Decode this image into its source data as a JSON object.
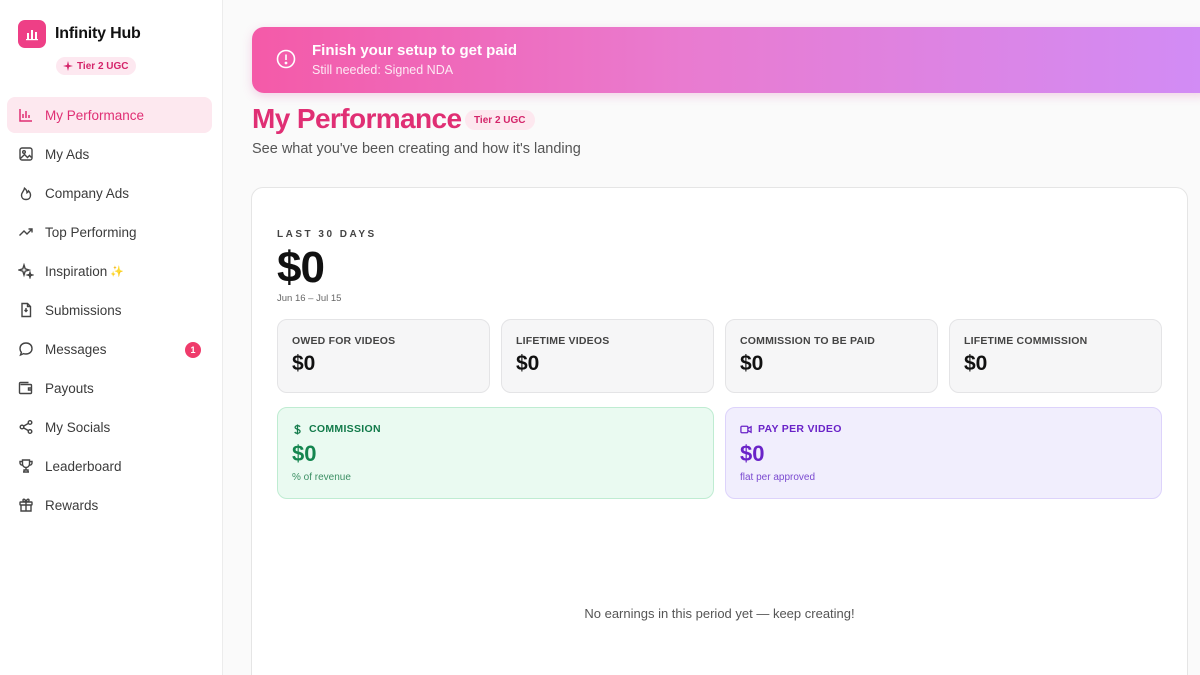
{
  "app": {
    "name": "Infinity Hub",
    "tier": "Tier 2 UGC",
    "brand_color": "#ee3f86"
  },
  "sidebar": {
    "items": [
      {
        "label": "My Performance",
        "icon": "bar-chart-icon",
        "active": true
      },
      {
        "label": "My Ads",
        "icon": "image-icon"
      },
      {
        "label": "Company Ads",
        "icon": "flame-icon"
      },
      {
        "label": "Top Performing",
        "icon": "trending-up-icon"
      },
      {
        "label": "Inspiration",
        "icon": "sparkles-icon",
        "suffix": "✨"
      },
      {
        "label": "Submissions",
        "icon": "file-icon"
      },
      {
        "label": "Messages",
        "icon": "message-icon",
        "badge": "1"
      },
      {
        "label": "Payouts",
        "icon": "wallet-icon"
      },
      {
        "label": "My Socials",
        "icon": "share-icon"
      },
      {
        "label": "Leaderboard",
        "icon": "trophy-icon"
      },
      {
        "label": "Rewards",
        "icon": "gift-icon"
      }
    ]
  },
  "banner": {
    "title": "Finish your setup to get paid",
    "subtitle": "Still needed: Signed NDA",
    "icon": "alert-circle-icon"
  },
  "header": {
    "title": "My Performance",
    "tier": "Tier 2 UGC",
    "subtitle": "See what you've been creating and how it's landing"
  },
  "period": {
    "label": "LAST 30 DAYS",
    "value": "$0",
    "range": "Jun 16 – Jul 15"
  },
  "stats": [
    {
      "label": "OWED FOR VIDEOS",
      "value": "$0"
    },
    {
      "label": "LIFETIME VIDEOS",
      "value": "$0"
    },
    {
      "label": "COMMISSION TO BE PAID",
      "value": "$0"
    },
    {
      "label": "LIFETIME COMMISSION",
      "value": "$0"
    }
  ],
  "rates": {
    "commission": {
      "label": "COMMISSION",
      "value": "$0",
      "sub": "% of revenue",
      "icon": "dollar-icon",
      "color": "#14854f"
    },
    "ppv": {
      "label": "PAY PER VIDEO",
      "value": "$0",
      "sub": "flat per approved",
      "icon": "video-icon",
      "color": "#6a23c8"
    }
  },
  "empty_message": "No earnings in this period yet — keep creating!"
}
